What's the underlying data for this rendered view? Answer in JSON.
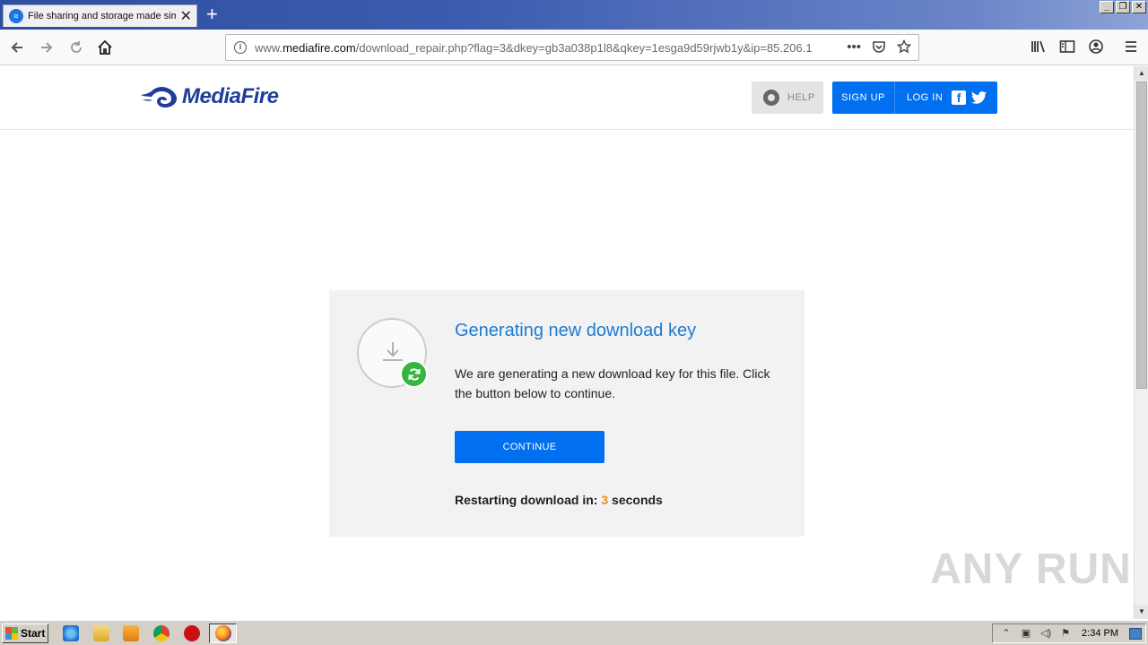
{
  "browser": {
    "tab_title": "File sharing and storage made simple",
    "url_prefix": "www.",
    "url_domain": "mediafire.com",
    "url_path": "/download_repair.php?flag=3&dkey=gb3a038p1l8&qkey=1esga9d59rjwb1y&ip=85.206.1",
    "window_buttons": [
      "_",
      "❐",
      "✕"
    ]
  },
  "site": {
    "logo_text": "MediaFire",
    "help_label": "HELP",
    "signup_label": "SIGN UP",
    "login_label": "LOG IN",
    "brand_color": "#0070f0",
    "facebook_glyph": "f"
  },
  "card": {
    "title": "Generating new download key",
    "description": "We are generating a new download key for this file. Click the button below to continue.",
    "continue_label": "CONTINUE",
    "countdown_prefix": "Restarting download in: ",
    "countdown_value": "3",
    "countdown_suffix": " seconds",
    "countdown_color": "#f08a1c"
  },
  "watermark": "ANY RUN",
  "taskbar": {
    "start_label": "Start",
    "clock": "2:34 PM",
    "pinned_icons": [
      "internet-explorer-icon",
      "folder-icon",
      "media-player-icon",
      "chrome-icon",
      "opera-icon",
      "firefox-icon"
    ]
  }
}
